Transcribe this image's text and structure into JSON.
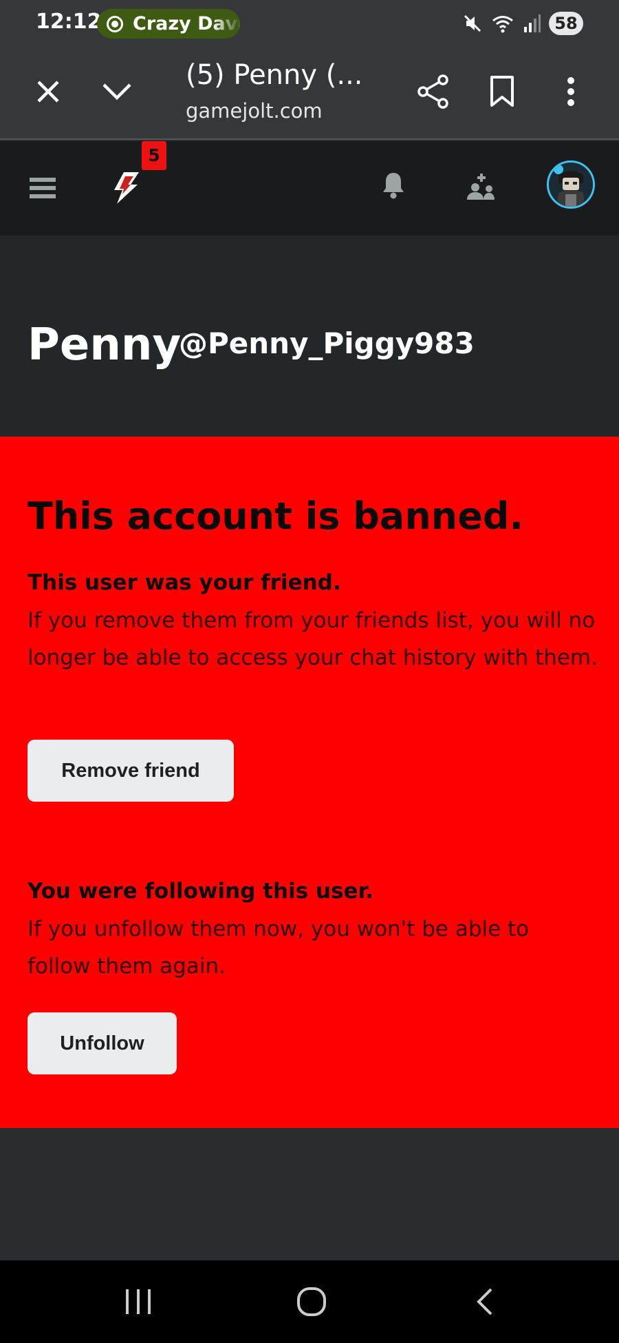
{
  "status_bar": {
    "time": "12:12",
    "media_label": "Crazy Dave",
    "battery": "58",
    "icons": [
      "mute-icon",
      "wifi-icon",
      "signal-icon"
    ]
  },
  "browser": {
    "page_title": "(5) Penny (...",
    "domain": "gamejolt.com",
    "icons": [
      "close-icon",
      "chevron-down-icon",
      "share-icon",
      "bookmark-icon",
      "more-vertical-icon"
    ]
  },
  "site_header": {
    "notification_count": "5",
    "icons": [
      "menu-icon",
      "gamejolt-logo-icon",
      "bell-icon",
      "friends-icon",
      "avatar"
    ],
    "accent_color": "#3ec3f1"
  },
  "profile": {
    "display_name": "Penny",
    "username": "@Penny_Piggy983"
  },
  "ban_notice": {
    "title": "This account is banned.",
    "friend_heading": "This user was your friend.",
    "friend_text": "If you remove them from your friends list, you will no longer be able to access your chat history with them.",
    "remove_friend_label": "Remove friend",
    "follow_heading": "You were following this user.",
    "follow_text": "If you unfollow them now, you won't be able to follow them again.",
    "unfollow_label": "Unfollow",
    "background_color": "#ff0000"
  },
  "nav_bar": {
    "icons": [
      "recents-icon",
      "home-icon",
      "back-icon"
    ]
  }
}
